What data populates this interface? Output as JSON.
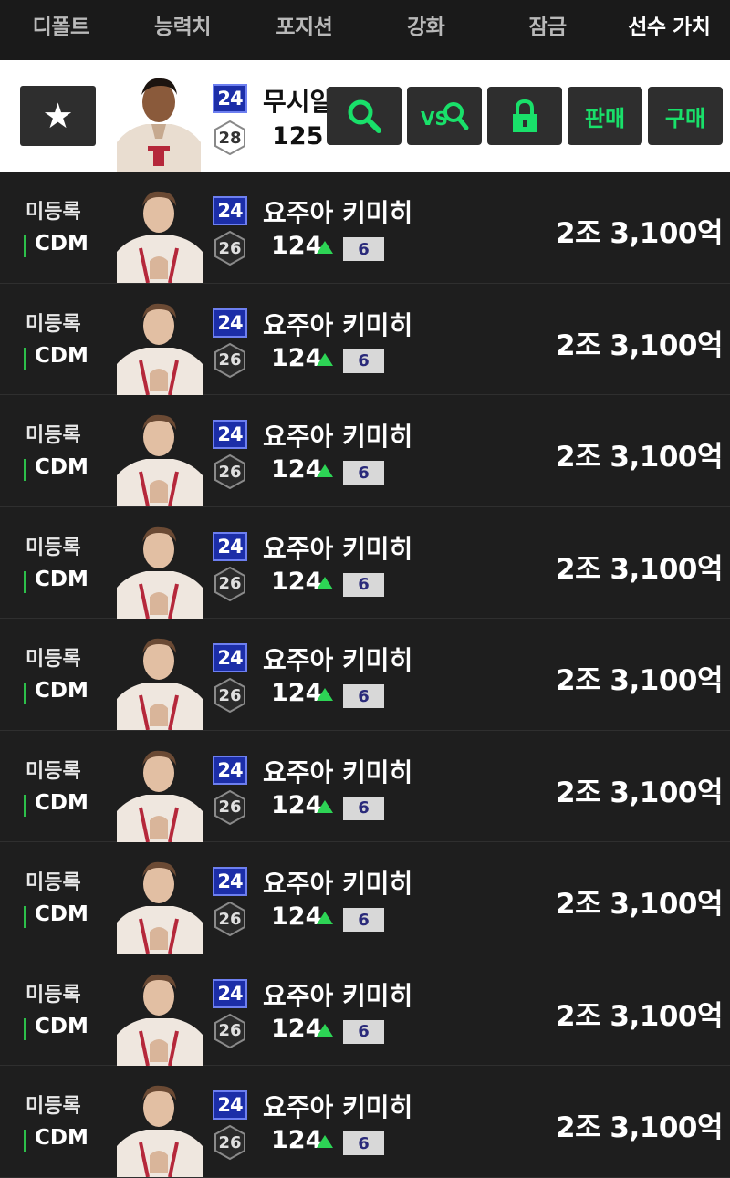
{
  "tabs": [
    "디폴트",
    "능력치",
    "포지션",
    "강화",
    "잠금",
    "선수 가치"
  ],
  "selected": {
    "name": "무시알라",
    "season": "24",
    "pay": "28",
    "ovr": "125",
    "buttons": {
      "search_icon": "search-icon",
      "vs_label": "VS",
      "lock_icon": "lock-icon",
      "sell": "판매",
      "buy": "구매"
    }
  },
  "rows": [
    {
      "status": "미등록",
      "pos": "CDM",
      "season": "24",
      "pay": "26",
      "name": "요주아 키미히",
      "ovr": "124",
      "enhance": "6",
      "price": "2조 3,100억"
    },
    {
      "status": "미등록",
      "pos": "CDM",
      "season": "24",
      "pay": "26",
      "name": "요주아 키미히",
      "ovr": "124",
      "enhance": "6",
      "price": "2조 3,100억"
    },
    {
      "status": "미등록",
      "pos": "CDM",
      "season": "24",
      "pay": "26",
      "name": "요주아 키미히",
      "ovr": "124",
      "enhance": "6",
      "price": "2조 3,100억"
    },
    {
      "status": "미등록",
      "pos": "CDM",
      "season": "24",
      "pay": "26",
      "name": "요주아 키미히",
      "ovr": "124",
      "enhance": "6",
      "price": "2조 3,100억"
    },
    {
      "status": "미등록",
      "pos": "CDM",
      "season": "24",
      "pay": "26",
      "name": "요주아 키미히",
      "ovr": "124",
      "enhance": "6",
      "price": "2조 3,100억"
    },
    {
      "status": "미등록",
      "pos": "CDM",
      "season": "24",
      "pay": "26",
      "name": "요주아 키미히",
      "ovr": "124",
      "enhance": "6",
      "price": "2조 3,100억"
    },
    {
      "status": "미등록",
      "pos": "CDM",
      "season": "24",
      "pay": "26",
      "name": "요주아 키미히",
      "ovr": "124",
      "enhance": "6",
      "price": "2조 3,100억"
    },
    {
      "status": "미등록",
      "pos": "CDM",
      "season": "24",
      "pay": "26",
      "name": "요주아 키미히",
      "ovr": "124",
      "enhance": "6",
      "price": "2조 3,100억"
    },
    {
      "status": "미등록",
      "pos": "CDM",
      "season": "24",
      "pay": "26",
      "name": "요주아 키미히",
      "ovr": "124",
      "enhance": "6",
      "price": "2조 3,100억"
    }
  ],
  "colors": {
    "accent": "#19e06a",
    "season_badge": "#1c2ea8",
    "up_arrow": "#2dd455",
    "position_bar": "#2dbf4a"
  }
}
